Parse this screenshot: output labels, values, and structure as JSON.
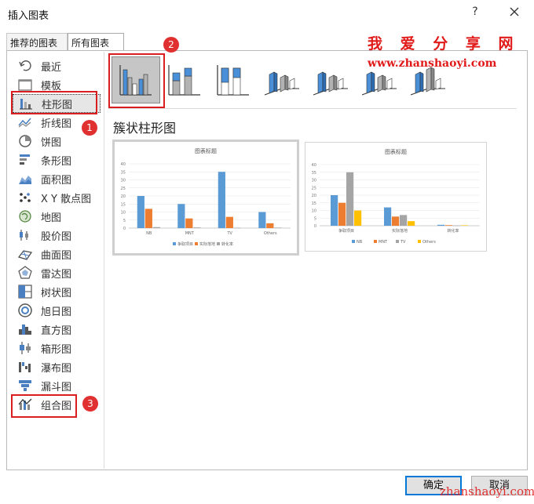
{
  "window": {
    "title": "插入图表",
    "help": "?"
  },
  "tabs": [
    {
      "label": "推荐的图表"
    },
    {
      "label": "所有图表"
    }
  ],
  "sidebar": {
    "items": [
      {
        "label": "最近",
        "icon": "recent-icon"
      },
      {
        "label": "模板",
        "icon": "template-folder-icon"
      },
      {
        "label": "柱形图",
        "icon": "column-chart-icon",
        "selected": true
      },
      {
        "label": "折线图",
        "icon": "line-chart-icon"
      },
      {
        "label": "饼图",
        "icon": "pie-chart-icon"
      },
      {
        "label": "条形图",
        "icon": "bar-chart-icon"
      },
      {
        "label": "面积图",
        "icon": "area-chart-icon"
      },
      {
        "label": "X Y 散点图",
        "icon": "scatter-chart-icon"
      },
      {
        "label": "地图",
        "icon": "map-chart-icon"
      },
      {
        "label": "股价图",
        "icon": "stock-chart-icon"
      },
      {
        "label": "曲面图",
        "icon": "surface-chart-icon"
      },
      {
        "label": "雷达图",
        "icon": "radar-chart-icon"
      },
      {
        "label": "树状图",
        "icon": "treemap-chart-icon"
      },
      {
        "label": "旭日图",
        "icon": "sunburst-chart-icon"
      },
      {
        "label": "直方图",
        "icon": "histogram-chart-icon"
      },
      {
        "label": "箱形图",
        "icon": "box-whisker-chart-icon"
      },
      {
        "label": "瀑布图",
        "icon": "waterfall-chart-icon"
      },
      {
        "label": "漏斗图",
        "icon": "funnel-chart-icon"
      },
      {
        "label": "组合图",
        "icon": "combo-chart-icon"
      }
    ]
  },
  "subtypes": [
    {
      "icon": "clustered-column-icon",
      "selected": true
    },
    {
      "icon": "stacked-column-icon"
    },
    {
      "icon": "100-stacked-column-icon"
    },
    {
      "icon": "3d-clustered-column-icon"
    },
    {
      "icon": "3d-stacked-column-icon"
    },
    {
      "icon": "3d-100-stacked-column-icon"
    },
    {
      "icon": "3d-column-icon"
    }
  ],
  "selected_subtype_title": "簇状柱形图",
  "badges": [
    "1",
    "2",
    "3"
  ],
  "colors": {
    "blue": "#5b9bd5",
    "orange": "#ed7d31",
    "gray": "#a5a5a5",
    "yellow": "#ffc000",
    "accent_red": "#d81e1e",
    "ok_border": "#0078d7"
  },
  "watermark": {
    "title": "我 爱 分 享 网",
    "url": "www.zhanshaoyi.com",
    "footer": "zhanshaoyi.com"
  },
  "buttons": {
    "ok": "确定",
    "cancel": "取消"
  },
  "chart_data": [
    {
      "type": "bar",
      "title": "图表标题",
      "categories": [
        "NB",
        "MNT",
        "TV",
        "Others"
      ],
      "series": [
        {
          "name": "争取项目",
          "values": [
            20,
            15,
            35,
            10
          ]
        },
        {
          "name": "实际落地",
          "values": [
            12,
            6,
            7,
            3
          ]
        },
        {
          "name": "转化率",
          "values": [
            0.6,
            0.4,
            0.2,
            0.3
          ]
        }
      ],
      "ylim": [
        0,
        40
      ],
      "yticks": [
        "0",
        "5",
        "10",
        "15",
        "20",
        "25",
        "30",
        "35",
        "40"
      ],
      "grid": true,
      "legend": "bottom"
    },
    {
      "type": "bar",
      "title": "图表标题",
      "categories": [
        "争取项目",
        "实际落地",
        "转化率"
      ],
      "series": [
        {
          "name": "NB",
          "values": [
            20,
            12,
            0.6
          ]
        },
        {
          "name": "MNT",
          "values": [
            15,
            6,
            0.4
          ]
        },
        {
          "name": "TV",
          "values": [
            35,
            7,
            0.2
          ]
        },
        {
          "name": "Others",
          "values": [
            10,
            3,
            0.3
          ]
        }
      ],
      "ylim": [
        0,
        40
      ],
      "yticks": [
        "0",
        "5",
        "10",
        "15",
        "20",
        "25",
        "30",
        "35",
        "40"
      ],
      "grid": true,
      "legend": "bottom"
    }
  ]
}
